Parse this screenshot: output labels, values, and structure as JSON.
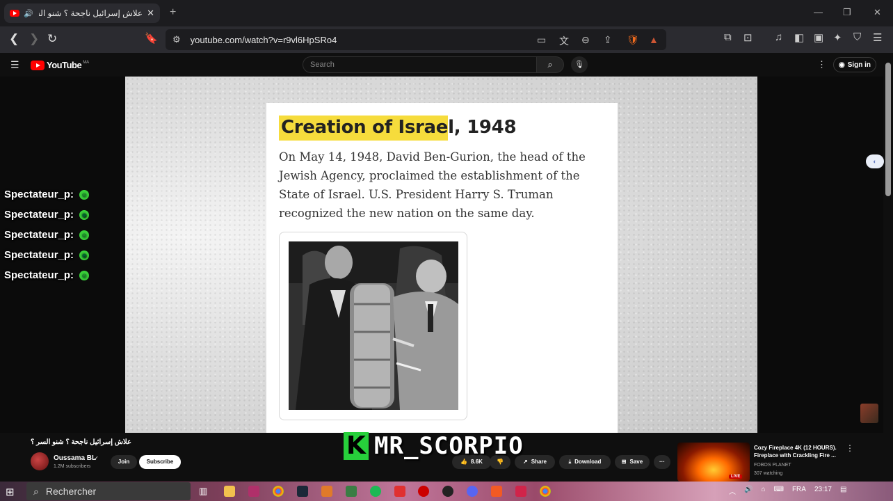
{
  "browser": {
    "tab_title": "علاش إسرائيل ناجحة ؟ شنو السر ؟",
    "tab_audio_icon": "speaker-icon",
    "new_tab": "+",
    "url": "youtube.com/watch?v=r9vl6HpSRo4",
    "window_controls": {
      "minimize": "—",
      "restore": "❐",
      "close": "✕"
    }
  },
  "youtube": {
    "logo": "YouTube",
    "region": "MA",
    "search_placeholder": "Search",
    "sign_in": "Sign in"
  },
  "video": {
    "card_title_highlighted": "Creation of Israe",
    "card_title_rest": "l, 1948",
    "card_body": "On May 14, 1948, David Ben-Gurion, the head of the Jewish Agency, proclaimed the establishment of the State of Israel. U.S. President Harry S. Truman recognized the new nation on the same day."
  },
  "chat": [
    {
      "user": "Spectateur_p:",
      "emoji": "☺"
    },
    {
      "user": "Spectateur_p:",
      "emoji": "☻"
    },
    {
      "user": "Spectateur_p:",
      "emoji": "☺"
    },
    {
      "user": "Spectateur_p:",
      "emoji": "☻"
    },
    {
      "user": "Spectateur_p:",
      "emoji": "☺"
    }
  ],
  "watermark": {
    "letter": "K",
    "text": "MR_SCORPIO"
  },
  "meta": {
    "title": "علاش إسرائيل ناجحة ؟ شنو السر ؟",
    "channel": "Oussama BL",
    "subscribers": "1.2M subscribers",
    "join": "Join",
    "subscribe": "Subscribe",
    "likes": "8.6K",
    "share": "Share",
    "download": "Download",
    "save": "Save",
    "more": "···"
  },
  "recommended": {
    "title": "Cozy Fireplace 4K (12 HOURS). Fireplace with Crackling Fire ...",
    "channel": "FOBOS PLANET",
    "watching": "307 watching",
    "live": "LIVE"
  },
  "taskbar": {
    "search": "Rechercher",
    "language": "FRA",
    "time": "23:17"
  },
  "colors": {
    "highlight": "#f6dc3c",
    "yt_red": "#ff0000",
    "watermark_green": "#27d03b",
    "chat_emoji_green": "#3ad23a"
  }
}
